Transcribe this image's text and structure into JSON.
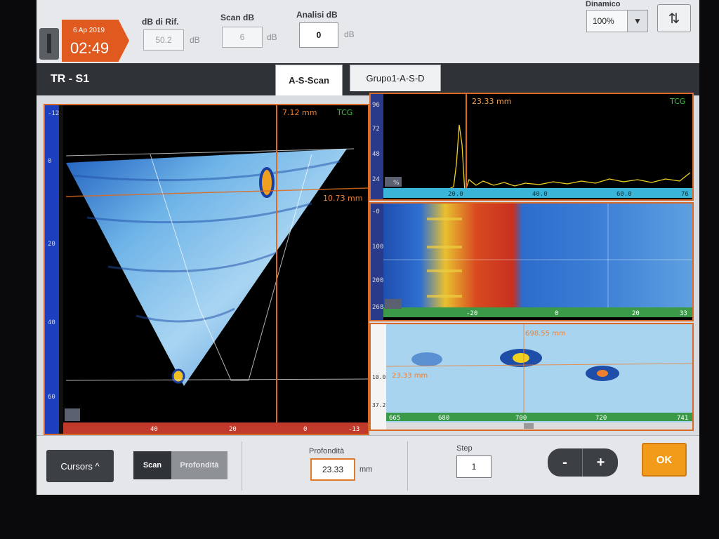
{
  "header": {
    "date": "6 Ap 2019",
    "time": "02:49",
    "db_rif": {
      "label": "dB di Rif.",
      "value": "50.2",
      "unit": "dB"
    },
    "scan_db": {
      "label": "Scan dB",
      "value": "6",
      "unit": "dB"
    },
    "analisi_db": {
      "label": "Analisi dB",
      "value": "0",
      "unit": "dB"
    },
    "dinamico": {
      "label": "Dinamico",
      "value": "100%"
    }
  },
  "title": "TR - S1",
  "tabs": [
    {
      "label": "A-S-Scan",
      "active": true
    },
    {
      "label": "Grupo1-A-S-D",
      "active": false
    }
  ],
  "sscan": {
    "cursor_label": "7.12 mm",
    "tcg": "TCG",
    "depth_cursor_label": "10.73 mm",
    "left_axis": [
      "-12",
      "0",
      "20",
      "40",
      "60"
    ],
    "bottom_axis": [
      "40",
      "20",
      "0",
      "-13"
    ]
  },
  "ascan": {
    "cursor_label": "23.33 mm",
    "tcg": "TCG",
    "left_axis": [
      "96",
      "72",
      "48",
      "24"
    ],
    "bottom_axis": [
      "20.0",
      "40.0",
      "60.0",
      "76"
    ],
    "gate_label": "%"
  },
  "bscan": {
    "left_axis": [
      "-0",
      "100",
      "200",
      "268"
    ],
    "bottom_axis": [
      "-20",
      "0",
      "20",
      "33"
    ]
  },
  "cscan": {
    "top_label": "698.55 mm",
    "left_label": "23.33 mm",
    "left_axis": [
      "10.0",
      "37.2"
    ],
    "bottom_axis": [
      "665",
      "680",
      "700",
      "720",
      "741"
    ]
  },
  "footer": {
    "cursors_label": "Cursors ^",
    "seg_scan": "Scan",
    "seg_profondita": "Profondità",
    "profondita_label": "Profondità",
    "profondita_value": "23.33",
    "profondita_unit": "mm",
    "step_label": "Step",
    "step_value": "1",
    "minus": "-",
    "plus": "+",
    "ok": "OK"
  },
  "colors": {
    "accent": "#d86a2a",
    "clock": "#e0591f",
    "ok": "#f29a1a",
    "tcg": "#3fbf3f",
    "signal": "#f0d020"
  }
}
